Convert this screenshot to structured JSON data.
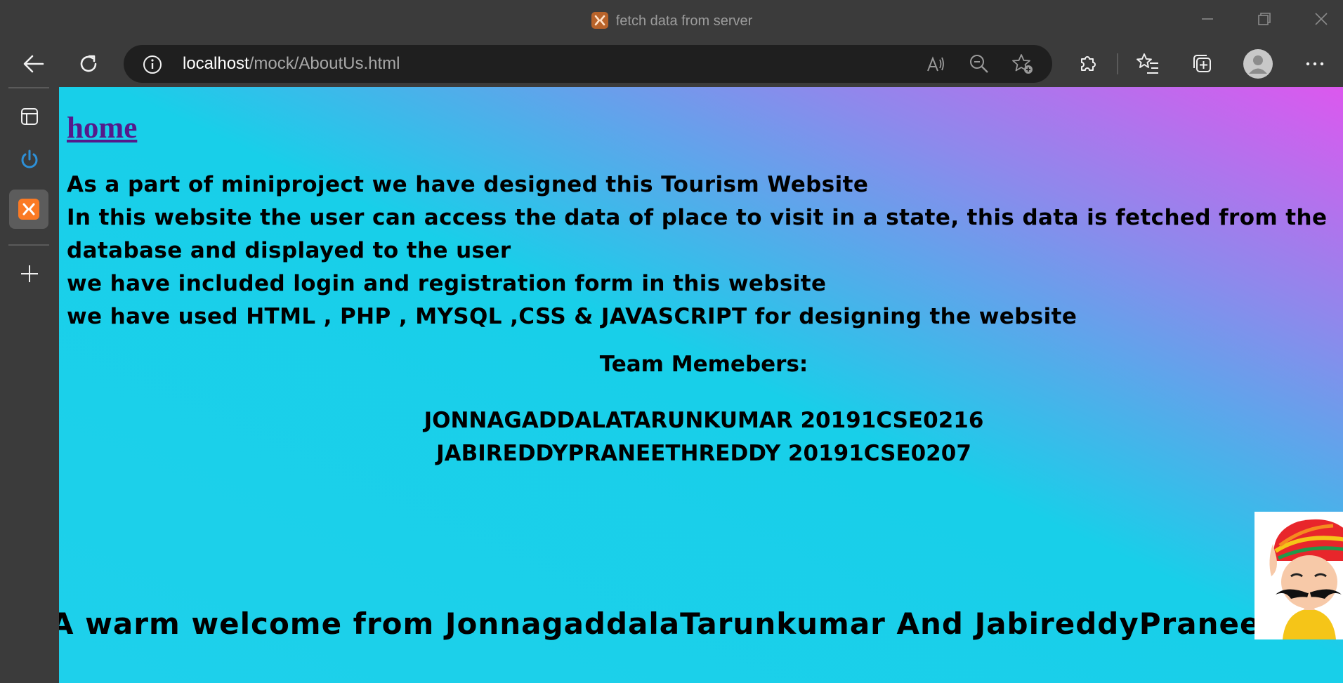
{
  "window": {
    "tab_title": "fetch data from server"
  },
  "toolbar": {
    "url_host": "localhost",
    "url_path": "/mock/AboutUs.html"
  },
  "page": {
    "home_link": "home",
    "intro_lines": [
      "As a part of miniproject we have designed this Tourism Website",
      "In this website the user can access the data of place to visit in a state, this data is fetched from the database and displayed to the user",
      "we have included login and registration form in this website",
      "we have used HTML , PHP , MYSQL ,CSS & JAVASCRIPT for designing the website"
    ],
    "team_heading": "Team Memebers:",
    "team_members": [
      "JONNAGADDALATARUNKUMAR 20191CSE0216",
      "JABIREDDYPRANEETHREDDY 20191CSE0207"
    ],
    "welcome_text": "A warm welcome from JonnagaddalaTarunkumar And JabireddyPraneethReddy"
  },
  "colors": {
    "gradient_start": "#1ed0eb",
    "gradient_end": "#dc58ee",
    "link": "#551a8b",
    "xampp_orange": "#fb7a24"
  }
}
